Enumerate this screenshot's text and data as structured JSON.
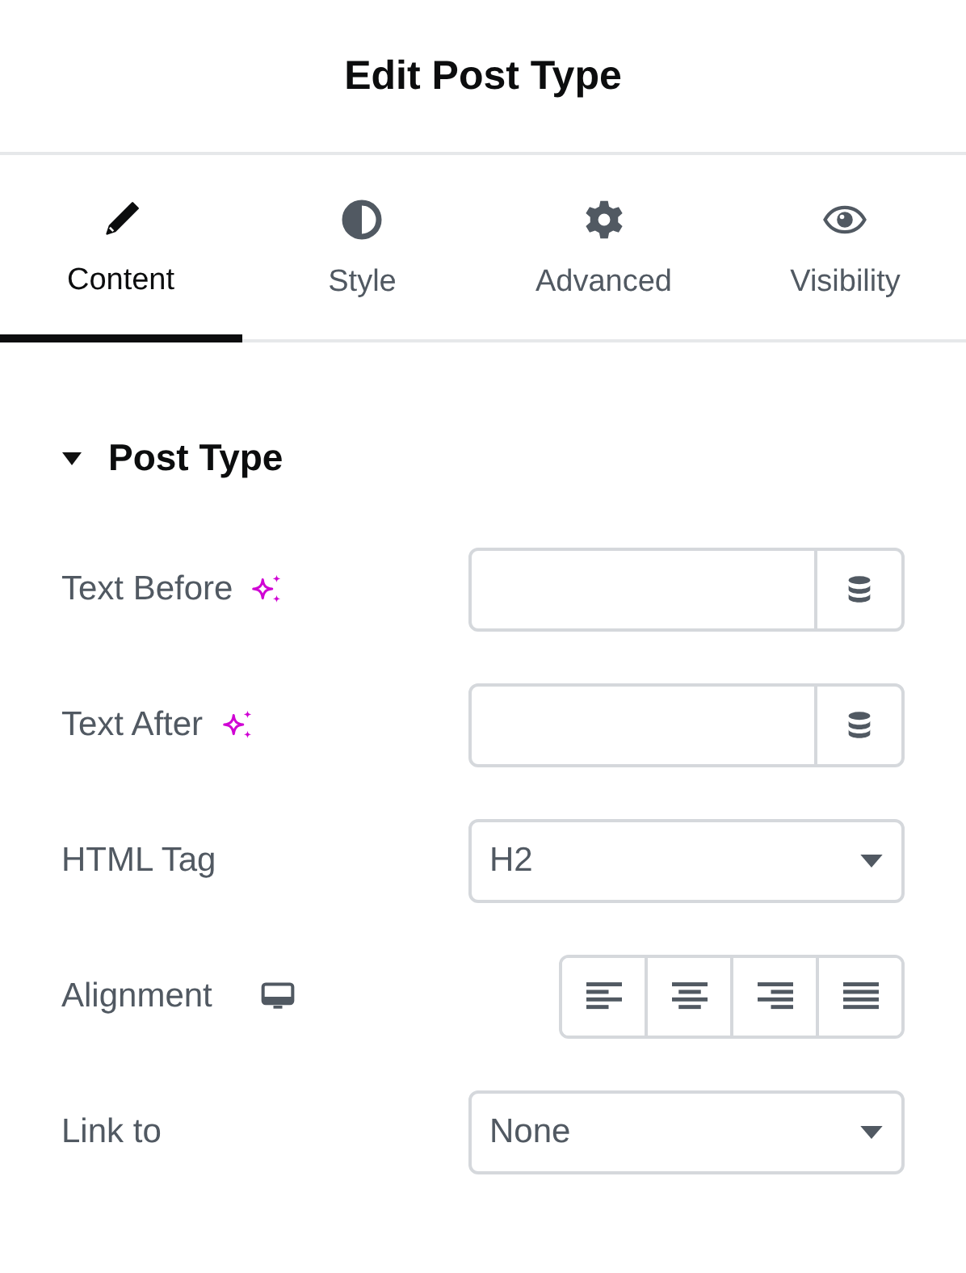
{
  "header": {
    "title": "Edit Post Type"
  },
  "tabs": [
    {
      "label": "Content",
      "selected": true
    },
    {
      "label": "Style",
      "selected": false
    },
    {
      "label": "Advanced",
      "selected": false
    },
    {
      "label": "Visibility",
      "selected": false
    }
  ],
  "section": {
    "title": "Post Type",
    "expanded": true
  },
  "controls": [
    {
      "kind": "text",
      "label": "Text Before"
    },
    {
      "kind": "text",
      "label": "Text After"
    },
    {
      "kind": "select",
      "label": "HTML Tag",
      "value": "H2"
    },
    {
      "kind": "choices",
      "label": "Alignment",
      "options": [
        {
          "selected": false
        },
        {
          "selected": false
        },
        {
          "selected": false
        },
        {
          "selected": false
        }
      ]
    },
    {
      "kind": "select",
      "label": "Link to",
      "value": "None"
    }
  ]
}
